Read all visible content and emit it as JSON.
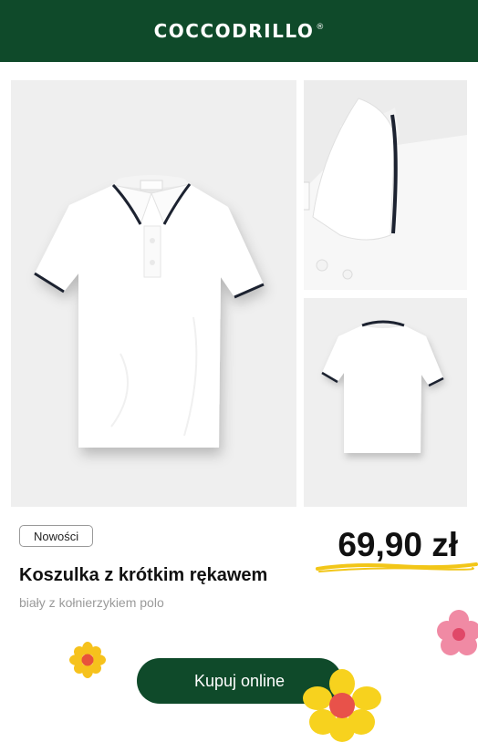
{
  "header": {
    "brand": "COCCODRILLO",
    "brand_mark": "®",
    "background": "#0f4a2a"
  },
  "gallery": {
    "images": [
      {
        "name": "main-photo",
        "icon": "white-polo-shirt-front"
      },
      {
        "name": "collar-detail",
        "icon": "polo-collar-closeup"
      },
      {
        "name": "back-photo",
        "icon": "white-polo-shirt-back"
      }
    ]
  },
  "product": {
    "badge": "Nowości",
    "title": "Koszulka z krótkim rękawem",
    "subtitle": "biały z kołnierzykiem polo",
    "price": "69,90 zł",
    "price_underline_color": "#f2c618"
  },
  "cta": {
    "label": "Kupuj online",
    "background": "#0f4a2a"
  },
  "decorations": {
    "flowers": [
      {
        "name": "orange-flower-icon",
        "petal_color": "#f6c21c",
        "center_color": "#e8523a"
      },
      {
        "name": "pink-flower-icon",
        "petal_color": "#f08aa4",
        "center_color": "#e04868"
      },
      {
        "name": "yellow-flower-icon",
        "petal_color": "#f7d21e",
        "center_color": "#e8524a"
      }
    ]
  }
}
